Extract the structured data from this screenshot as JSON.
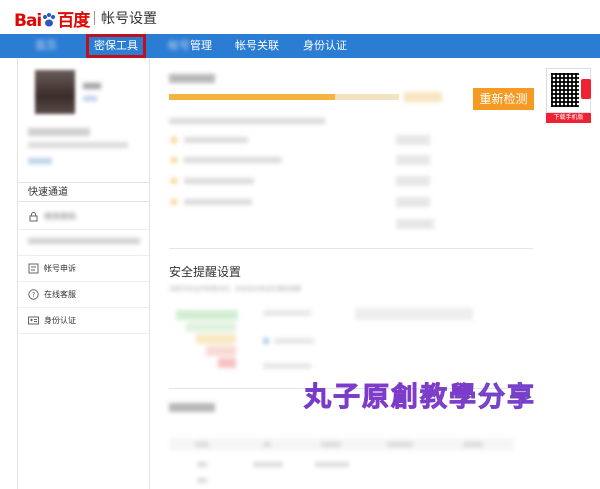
{
  "header": {
    "logo_part1": "Bai",
    "logo_part2": "百度",
    "title": "帐号设置"
  },
  "nav": {
    "items": [
      {
        "label": "首页",
        "blurred": true
      },
      {
        "label": "密保工具",
        "active": true
      },
      {
        "label": "帐号管理",
        "blurred_prefix": true
      },
      {
        "label": "帐号关联"
      },
      {
        "label": "身份认证"
      }
    ]
  },
  "sidebar": {
    "quick_title": "快速通道",
    "items": [
      {
        "icon": "lock-icon",
        "label": "修改密码"
      },
      {
        "icon": "user-icon",
        "label": ""
      },
      {
        "icon": "appeal-icon",
        "label": "帐号申诉"
      },
      {
        "icon": "help-icon",
        "label": "在线客服"
      },
      {
        "icon": "id-card-icon",
        "label": "身份认证"
      }
    ]
  },
  "main": {
    "security_title": "",
    "recheck_button": "重新检测",
    "qr_label": "下载手机版",
    "alert_title": "安全提醒设置",
    "alert_desc": "当帐号安全异常情况时，系统自动发送的通知提醒",
    "watermark": "丸子原創教學分享",
    "progress": 0.72
  },
  "colors": {
    "nav_bg": "#2b7cd3",
    "accent_orange": "#f59a23",
    "highlight_red": "#c0101a"
  }
}
